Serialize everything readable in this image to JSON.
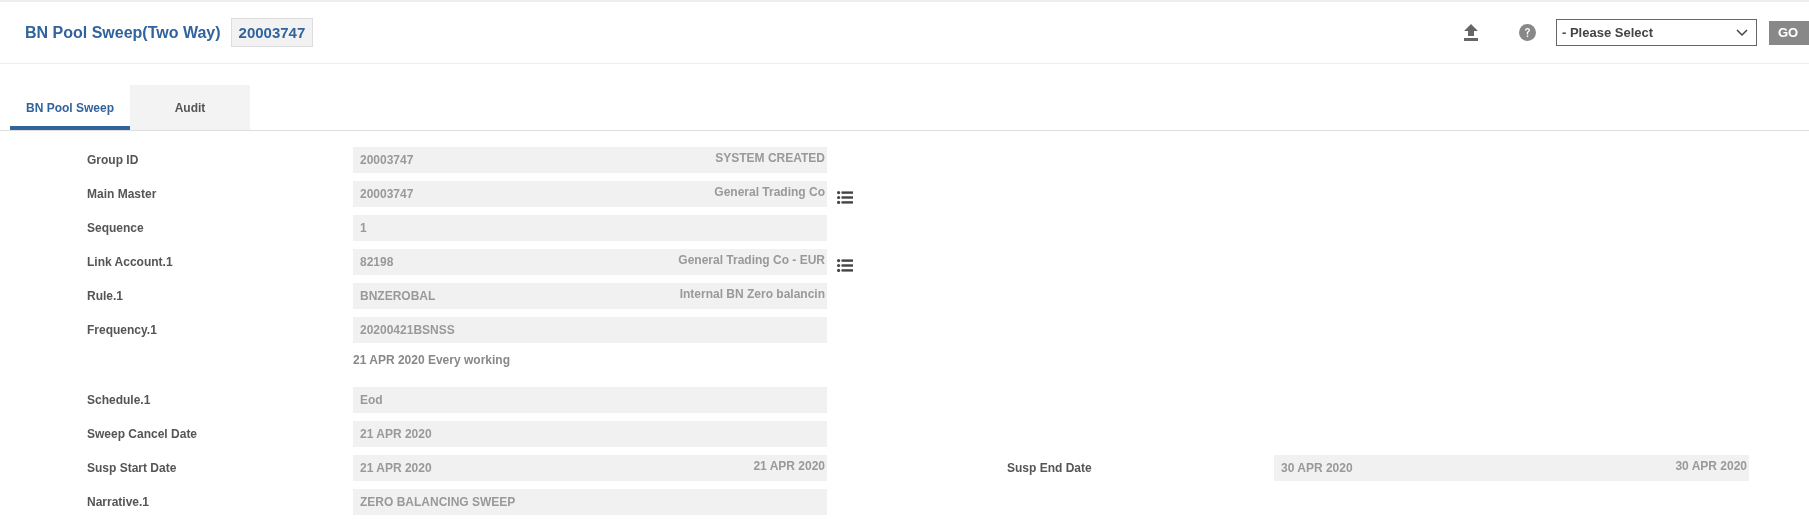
{
  "header": {
    "title": "BN Pool Sweep(Two Way)",
    "record_id": "20003747",
    "select": {
      "placeholder": "- Please Select"
    },
    "go_button": "GO"
  },
  "tabs": [
    {
      "label": "BN Pool Sweep",
      "selected": true
    },
    {
      "label": "Audit",
      "selected": false
    }
  ],
  "fields": [
    {
      "label": "Group ID",
      "value": "20003747",
      "aside": "SYSTEM CREATED",
      "lookup": false
    },
    {
      "label": "Main Master",
      "value": "20003747",
      "aside": "General Trading Co",
      "lookup": true
    },
    {
      "label": "Sequence",
      "value": "1",
      "lookup": false
    },
    {
      "label": "Link Account.1",
      "value": "82198",
      "aside": "General Trading Co - EUR",
      "lookup": true
    },
    {
      "label": "Rule.1",
      "value": "BNZEROBAL",
      "aside": "Internal BN Zero balancin",
      "lookup": false
    },
    {
      "label": "Frequency.1",
      "value": "20200421BSNSS",
      "note": "21 APR 2020 Every working",
      "lookup": false
    },
    {
      "label": "Schedule.1",
      "value": "Eod",
      "lookup": false
    },
    {
      "label": "Sweep Cancel Date",
      "value": "21 APR 2020",
      "lookup": false
    },
    {
      "label": "Susp Start Date",
      "value": "21 APR 2020",
      "aside": "21 APR 2020",
      "lookup": false,
      "pair": {
        "label": "Susp End Date",
        "value": "30 APR 2020",
        "aside": "30 APR 2020"
      }
    },
    {
      "label": "Narrative.1",
      "value": "ZERO BALANCING SWEEP",
      "lookup": false
    }
  ]
}
